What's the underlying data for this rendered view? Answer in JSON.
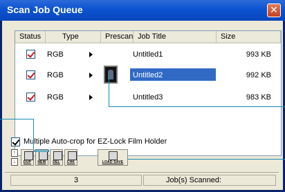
{
  "window": {
    "title": "Scan Job Queue",
    "close_glyph": "✕"
  },
  "columns": [
    "Status",
    "Type",
    "Prescan",
    "Job Title",
    "Size"
  ],
  "rows": [
    {
      "type": "RGB",
      "title": "Untitled1",
      "size": "993 KB"
    },
    {
      "type": "RGB",
      "title": "Untitled2",
      "size": "992 KB"
    },
    {
      "type": "RGB",
      "title": "Untitled3",
      "size": "983 KB"
    }
  ],
  "option_label": "Multiple Auto-crop for EZ-Lock Film Holder",
  "stepper": {
    "up": "↑",
    "down": "↓"
  },
  "toolbar": [
    {
      "label": "DUP",
      "icon": "duplicate-icon"
    },
    {
      "label": "NEW",
      "icon": "new-icon"
    },
    {
      "label": "DEL",
      "icon": "trash-icon"
    },
    {
      "label": "CHK",
      "icon": "check-icon"
    },
    {
      "label": "LOAD SAVE",
      "icon": "floppy-icon"
    }
  ],
  "status_bar": {
    "count": "3",
    "label": "Job(s) Scanned:"
  },
  "colors": {
    "accent": "#0b53d0",
    "selection": "#316ac5",
    "callout": "#178bb8"
  }
}
